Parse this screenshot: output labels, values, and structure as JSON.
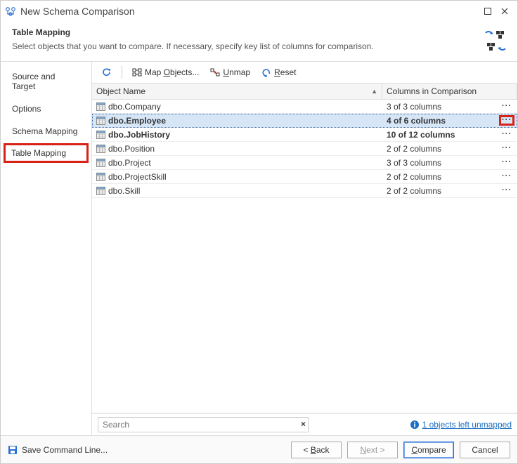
{
  "window": {
    "title": "New Schema Comparison"
  },
  "header": {
    "title": "Table Mapping",
    "description": "Select objects that you want to compare. If necessary, specify key list of columns for comparison."
  },
  "nav": {
    "items": [
      {
        "label": "Source and Target",
        "selected": false
      },
      {
        "label": "Options",
        "selected": false
      },
      {
        "label": "Schema Mapping",
        "selected": false
      },
      {
        "label": "Table Mapping",
        "selected": true
      }
    ]
  },
  "toolbar": {
    "refresh": "",
    "map_objects": "Map Objects...",
    "unmap": "Unmap",
    "reset": "Reset"
  },
  "grid": {
    "headers": {
      "name": "Object Name",
      "cols": "Columns in Comparison"
    },
    "rows": [
      {
        "name": "dbo.Company",
        "cols": "3 of 3 columns",
        "bold": false,
        "selected": false,
        "highlight_ellipsis": false
      },
      {
        "name": "dbo.Employee",
        "cols": "4 of 6 columns",
        "bold": true,
        "selected": true,
        "highlight_ellipsis": true
      },
      {
        "name": "dbo.JobHistory",
        "cols": "10 of 12 columns",
        "bold": true,
        "selected": false,
        "highlight_ellipsis": false
      },
      {
        "name": "dbo.Position",
        "cols": "2 of 2 columns",
        "bold": false,
        "selected": false,
        "highlight_ellipsis": false
      },
      {
        "name": "dbo.Project",
        "cols": "3 of 3 columns",
        "bold": false,
        "selected": false,
        "highlight_ellipsis": false
      },
      {
        "name": "dbo.ProjectSkill",
        "cols": "2 of 2 columns",
        "bold": false,
        "selected": false,
        "highlight_ellipsis": false
      },
      {
        "name": "dbo.Skill",
        "cols": "2 of 2 columns",
        "bold": false,
        "selected": false,
        "highlight_ellipsis": false
      }
    ]
  },
  "search": {
    "placeholder": "Search",
    "value": ""
  },
  "status": {
    "unmapped_link": "1 objects left unmapped"
  },
  "footer": {
    "save_cmd": "Save Command Line...",
    "back": "< Back",
    "next": "Next >",
    "compare": "Compare",
    "cancel": "Cancel"
  }
}
